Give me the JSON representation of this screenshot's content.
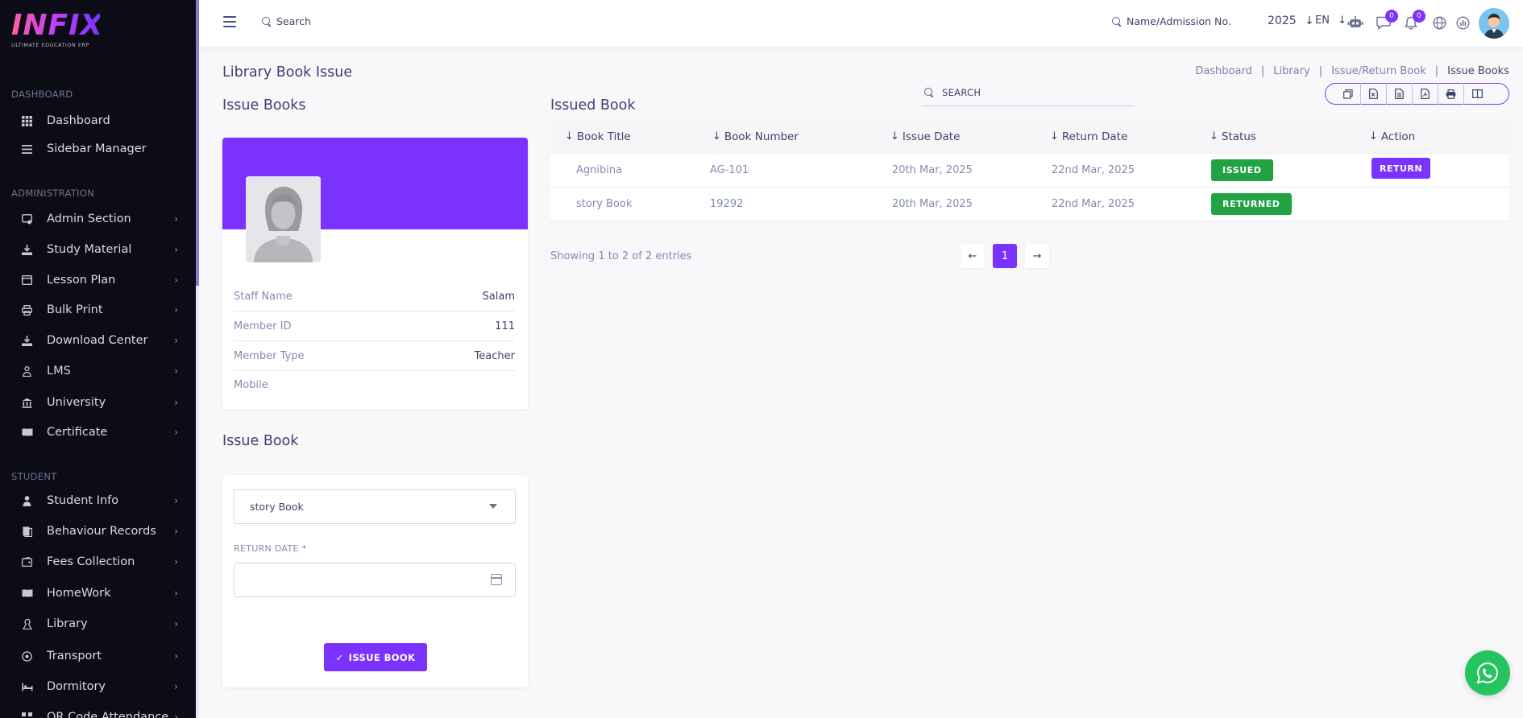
{
  "brand": {
    "logo_text": "INFIX",
    "tagline": "ULTIMATE EDUCATION ERP"
  },
  "sidebar": {
    "sections": [
      {
        "title": "DASHBOARD",
        "items": [
          {
            "label": "Dashboard",
            "icon": "grid-icon",
            "has_chevron": false
          },
          {
            "label": "Sidebar Manager",
            "icon": "list-icon",
            "has_chevron": false
          }
        ]
      },
      {
        "title": "ADMINISTRATION",
        "items": [
          {
            "label": "Admin Section",
            "icon": "admin-icon",
            "has_chevron": true
          },
          {
            "label": "Study Material",
            "icon": "download-icon",
            "has_chevron": true
          },
          {
            "label": "Lesson Plan",
            "icon": "calendar-icon",
            "has_chevron": true
          },
          {
            "label": "Bulk Print",
            "icon": "printer-icon",
            "has_chevron": true
          },
          {
            "label": "Download Center",
            "icon": "download-icon",
            "has_chevron": true
          },
          {
            "label": "LMS",
            "icon": "user-icon",
            "has_chevron": true
          },
          {
            "label": "University",
            "icon": "bank-icon",
            "has_chevron": true
          },
          {
            "label": "Certificate",
            "icon": "book-icon",
            "has_chevron": true
          }
        ]
      },
      {
        "title": "STUDENT",
        "items": [
          {
            "label": "Student Info",
            "icon": "student-icon",
            "has_chevron": true
          },
          {
            "label": "Behaviour Records",
            "icon": "records-icon",
            "has_chevron": true
          },
          {
            "label": "Fees Collection",
            "icon": "fees-icon",
            "has_chevron": true
          },
          {
            "label": "HomeWork",
            "icon": "book-icon",
            "has_chevron": true
          },
          {
            "label": "Library",
            "icon": "library-icon",
            "has_chevron": true
          },
          {
            "label": "Transport",
            "icon": "transport-icon",
            "has_chevron": true
          },
          {
            "label": "Dormitory",
            "icon": "bed-icon",
            "has_chevron": true
          },
          {
            "label": "QR Code Attendance",
            "icon": "qr-icon",
            "has_chevron": true
          }
        ]
      }
    ]
  },
  "header": {
    "search_label": "Search",
    "name_search_label": "Name/Admission No.",
    "year": "2025",
    "language": "EN",
    "messages_count": "0",
    "notifications_count": "0"
  },
  "page": {
    "title": "Library Book Issue",
    "breadcrumb": [
      "Dashboard",
      "Library",
      "Issue/Return Book",
      "Issue Books"
    ]
  },
  "issue_books": {
    "title": "Issue Books",
    "profile": [
      {
        "label": "Staff Name",
        "value": "Salam"
      },
      {
        "label": "Member ID",
        "value": "111"
      },
      {
        "label": "Member Type",
        "value": "Teacher"
      },
      {
        "label": "Mobile",
        "value": ""
      }
    ]
  },
  "issue_book_form": {
    "title": "Issue Book",
    "book_selected": "story Book",
    "return_date_label": "RETURN DATE",
    "return_date_required": "*",
    "return_date_value": "",
    "submit_label": "ISSUE BOOK"
  },
  "issued_book": {
    "title": "Issued Book",
    "search_label": "SEARCH",
    "columns": [
      "Book Title",
      "Book Number",
      "Issue Date",
      "Return Date",
      "Status",
      "Action"
    ],
    "rows": [
      {
        "title": "Agnibina",
        "number": "AG-101",
        "issue_date": "20th Mar, 2025",
        "return_date": "22nd Mar, 2025",
        "status": "ISSUED",
        "action": "RETURN"
      },
      {
        "title": "story Book",
        "number": "19292",
        "issue_date": "20th Mar, 2025",
        "return_date": "22nd Mar, 2025",
        "status": "RETURNED",
        "action": ""
      }
    ],
    "showing_text": "Showing 1 to 2 of 2 entries",
    "current_page": "1"
  },
  "colors": {
    "primary": "#7c32ff",
    "success": "#23a244",
    "sidebar": "#0c0c17",
    "text": "#41406b",
    "whatsapp": "#25c460"
  }
}
